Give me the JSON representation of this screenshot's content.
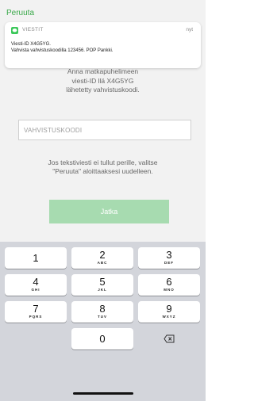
{
  "header": {
    "cancel_label": "Peruuta"
  },
  "notification": {
    "app_name": "VIESTIT",
    "time": "nyt",
    "line1": "Viesti-ID X4G5YG.",
    "line2": "Vahvista vahvistuskoodilla 123456. POP Pankki.",
    "icon": "messages-icon",
    "accent": "#3cc85a"
  },
  "main": {
    "instruction_lines": [
      "Anna matkapuhelimeen",
      "viesti-ID llä X4G5YG",
      "lähetetty vahvistuskoodi."
    ],
    "code_placeholder": "VAHVISTUSKOODI",
    "help_lines": [
      "Jos tekstiviesti ei tullut perille, valitse",
      "\"Peruuta\" aloittaaksesi uudelleen."
    ],
    "continue_label": "Jatka",
    "continue_color": "#a7dbb0"
  },
  "keypad": {
    "keys": [
      {
        "digit": "1",
        "letters": ""
      },
      {
        "digit": "2",
        "letters": "ABC"
      },
      {
        "digit": "3",
        "letters": "DEF"
      },
      {
        "digit": "4",
        "letters": "GHI"
      },
      {
        "digit": "5",
        "letters": "JKL"
      },
      {
        "digit": "6",
        "letters": "MNO"
      },
      {
        "digit": "7",
        "letters": "PQRS"
      },
      {
        "digit": "8",
        "letters": "TUV"
      },
      {
        "digit": "9",
        "letters": "WXYZ"
      },
      {
        "digit": "0",
        "letters": ""
      }
    ],
    "delete_icon": "backspace-icon"
  }
}
